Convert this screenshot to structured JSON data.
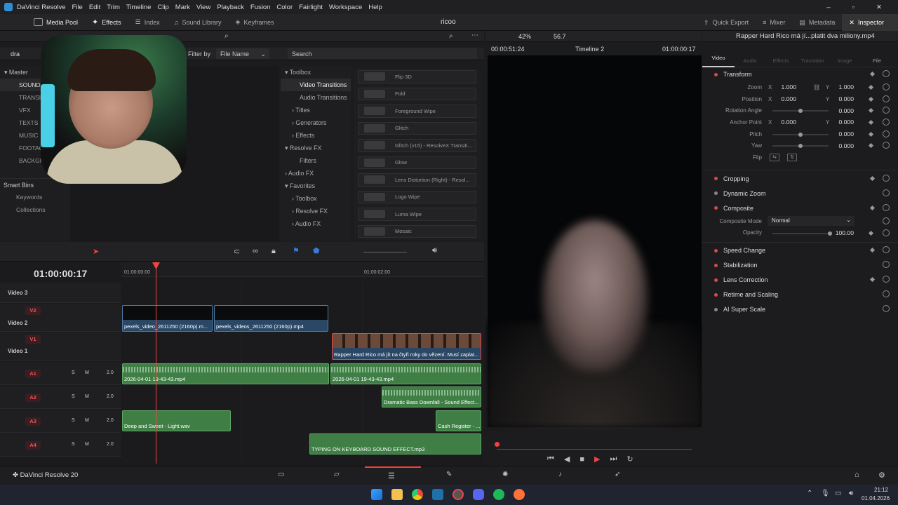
{
  "menubar": {
    "app_title": "DaVinci Resolve",
    "items": [
      "File",
      "Edit",
      "Trim",
      "Timeline",
      "Clip",
      "Mark",
      "View",
      "Playback",
      "Fusion",
      "Color",
      "Fairlight",
      "Workspace",
      "Help"
    ]
  },
  "toolbar": {
    "left": [
      "Media Pool",
      "Effects",
      "Index",
      "Sound Library",
      "Keyframes"
    ],
    "project": "ricoo",
    "right": [
      "Quick Export",
      "Mixer",
      "Metadata",
      "Inspector"
    ]
  },
  "mediapool": {
    "search_value": "dra",
    "filter_label": "Filter by",
    "filter_value": "File Name",
    "master": "Master",
    "bins": [
      "SOUND",
      "TRANSI",
      "VFX",
      "TEXTS",
      "MUSIC",
      "FOOTAG",
      "BACKGR"
    ],
    "smart_bins": "Smart Bins",
    "smart_items": [
      "Keywords",
      "Collections"
    ]
  },
  "effects": {
    "search_placeholder": "Search",
    "tree": [
      {
        "label": "Toolbox",
        "level": 0,
        "open": true
      },
      {
        "label": "Video Transitions",
        "level": 1,
        "selected": true
      },
      {
        "label": "Audio Transitions",
        "level": 1
      },
      {
        "label": "Titles",
        "level": 1,
        "arrow": true
      },
      {
        "label": "Generators",
        "level": 1,
        "arrow": true
      },
      {
        "label": "Effects",
        "level": 1,
        "arrow": true
      },
      {
        "label": "Resolve FX",
        "level": 0,
        "open": true
      },
      {
        "label": "Filters",
        "level": 1
      },
      {
        "label": "Audio FX",
        "level": 0,
        "arrow": true
      },
      {
        "label": "Favorites",
        "level": 0,
        "open": true
      },
      {
        "label": "Toolbox",
        "level": 1,
        "arrow": true
      },
      {
        "label": "Resolve FX",
        "level": 1,
        "arrow": true
      },
      {
        "label": "Audio FX",
        "level": 1,
        "arrow": true
      }
    ],
    "list": [
      "Flip 3D",
      "Fold",
      "Foreground Wipe",
      "Glitch",
      "Glitch (v15) - ResolveX Transiti...",
      "Glow",
      "Lens Distortion (Right) - Resol...",
      "Logo Wipe",
      "Luma Wipe",
      "Mosaic"
    ]
  },
  "viewer": {
    "zoom": "42%",
    "fps": "56.7",
    "timecode_left": "00:00:51:24",
    "timeline_name": "Timeline 2",
    "timecode_right": "01:00:00:17"
  },
  "inspector": {
    "clip_name": "Rapper Hard Rico má jí...platit dva miliony.mp4",
    "tabs": [
      "Video",
      "Audio",
      "Effects",
      "Transition",
      "Image",
      "File"
    ],
    "transform_title": "Transform",
    "transform": [
      {
        "label": "Zoom",
        "x": "1.000",
        "y": "1.000"
      },
      {
        "label": "Position",
        "x": "0.000",
        "y": "0.000"
      },
      {
        "label": "Rotation Angle",
        "v": "0.000",
        "slider": 0.5
      },
      {
        "label": "Anchor Point",
        "x": "0.000",
        "y": "0.000"
      },
      {
        "label": "Pitch",
        "v": "0.000",
        "slider": 0.5
      },
      {
        "label": "Yaw",
        "v": "0.000",
        "slider": 0.5
      },
      {
        "label": "Flip"
      }
    ],
    "cropping": "Cropping",
    "dynamic_zoom": "Dynamic Zoom",
    "composite": "Composite",
    "composite_mode_label": "Composite Mode",
    "composite_mode": "Normal",
    "opacity_label": "Opacity",
    "opacity": "100.00",
    "opacity_level": 1.0,
    "sections": [
      "Speed Change",
      "Stabilization",
      "Lens Correction",
      "Retime and Scaling",
      "AI Super Scale"
    ]
  },
  "timeline": {
    "timecode": "01:00:00:17",
    "ruler": [
      "01:00:00:00",
      "01:00:02:00"
    ],
    "tracks": [
      {
        "id": "V3",
        "name": "Video 3"
      },
      {
        "id": "V2",
        "name": "Video 2"
      },
      {
        "id": "V1",
        "name": "Video 1"
      },
      {
        "id": "A1",
        "gain": "2.0"
      },
      {
        "id": "A2",
        "gain": "2.0"
      },
      {
        "id": "A3",
        "gain": "2.0"
      },
      {
        "id": "A4",
        "gain": "2.0"
      }
    ],
    "clips": {
      "v2a": "pexels_video_2611250 (2160p).m...",
      "v2b": "pexels_videos_2611250 (2160p).mp4",
      "v1": "Rapper Hard Rico má jít na čtyři roky do vězení. Musí zaplat...",
      "a1a": "2026-04-01 19-43-43.mp4",
      "a1b": "2026-04-01 19-43-43.mp4",
      "a2": "Dramatic Bass Downfall - Sound Effect...",
      "a3a": "Deep and Sweet - Light.wav",
      "a3b": "Cash Register - ...",
      "a4": "TYPING ON KEYBOARD SOUND EFFECT.mp3"
    },
    "s_label": "S",
    "m_label": "M"
  },
  "pagebar": {
    "brand": "DaVinci Resolve 20"
  },
  "taskbar": {
    "time": "21:12",
    "date": "01.04.2026"
  },
  "colors": {
    "accent": "#e44444",
    "video_clip": "#2a4866",
    "audio_clip": "#3f7f45"
  }
}
